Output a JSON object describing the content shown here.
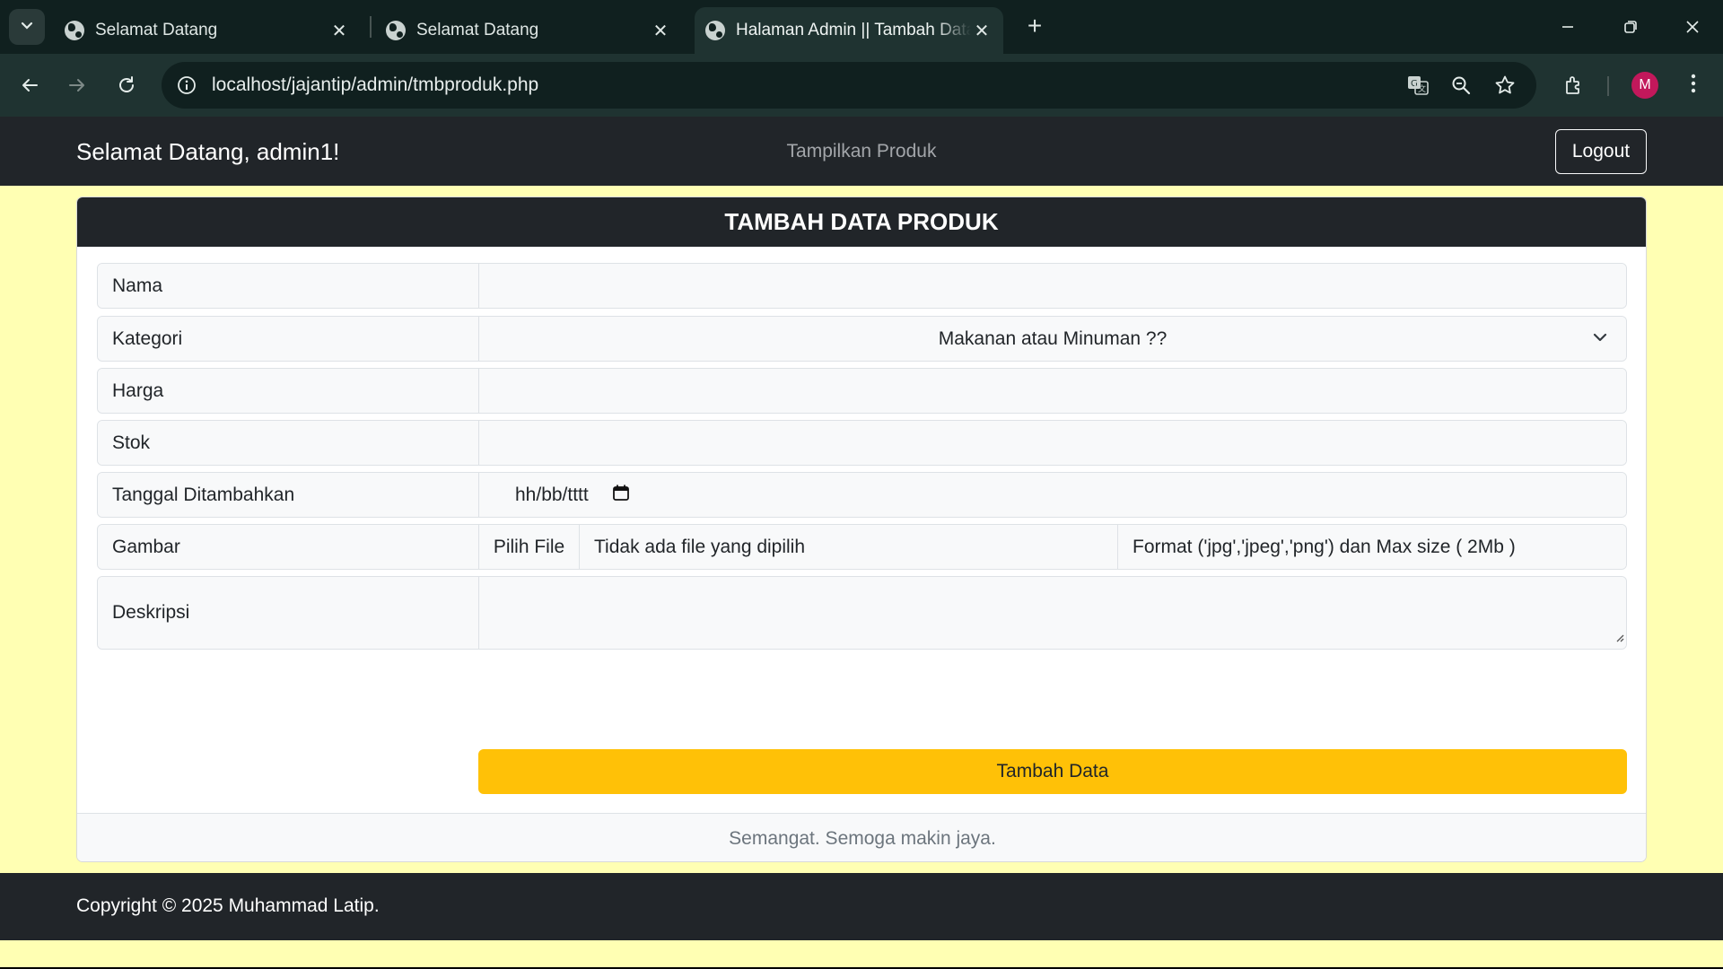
{
  "browser": {
    "tabs": [
      {
        "title": "Selamat Datang",
        "active": false
      },
      {
        "title": "Selamat Datang",
        "active": false
      },
      {
        "title": "Halaman Admin || Tambah Data",
        "active": true
      }
    ],
    "url": "localhost/jajantip/admin/tmbproduk.php",
    "profile_initial": "M"
  },
  "navbar": {
    "brand": "Selamat Datang, admin1!",
    "link": "Tampilkan Produk",
    "logout_label": "Logout"
  },
  "form": {
    "header": "TAMBAH DATA PRODUK",
    "nama_label": "Nama",
    "nama_value": "",
    "kategori_label": "Kategori",
    "kategori_selected": "Makanan atau Minuman ??",
    "harga_label": "Harga",
    "harga_value": "",
    "stok_label": "Stok",
    "stok_value": "",
    "tanggal_label": "Tanggal Ditambahkan",
    "tanggal_placeholder": "hh/bb/tttt",
    "gambar_label": "Gambar",
    "gambar_button": "Pilih File",
    "gambar_status": "Tidak ada file yang dipilih",
    "gambar_hint": "Format ('jpg','jpeg','png') dan Max size ( 2Mb )",
    "deskripsi_label": "Deskripsi",
    "deskripsi_value": "",
    "submit_label": "Tambah Data",
    "footer_text": "Semangat. Semoga makin jaya."
  },
  "footer": {
    "copyright": "Copyright © 2025 Muhammad Latip."
  },
  "colors": {
    "page_background": "#ffffb3",
    "dark": "#212529",
    "submit_button": "#ffc107",
    "avatar": "#c2185b"
  }
}
